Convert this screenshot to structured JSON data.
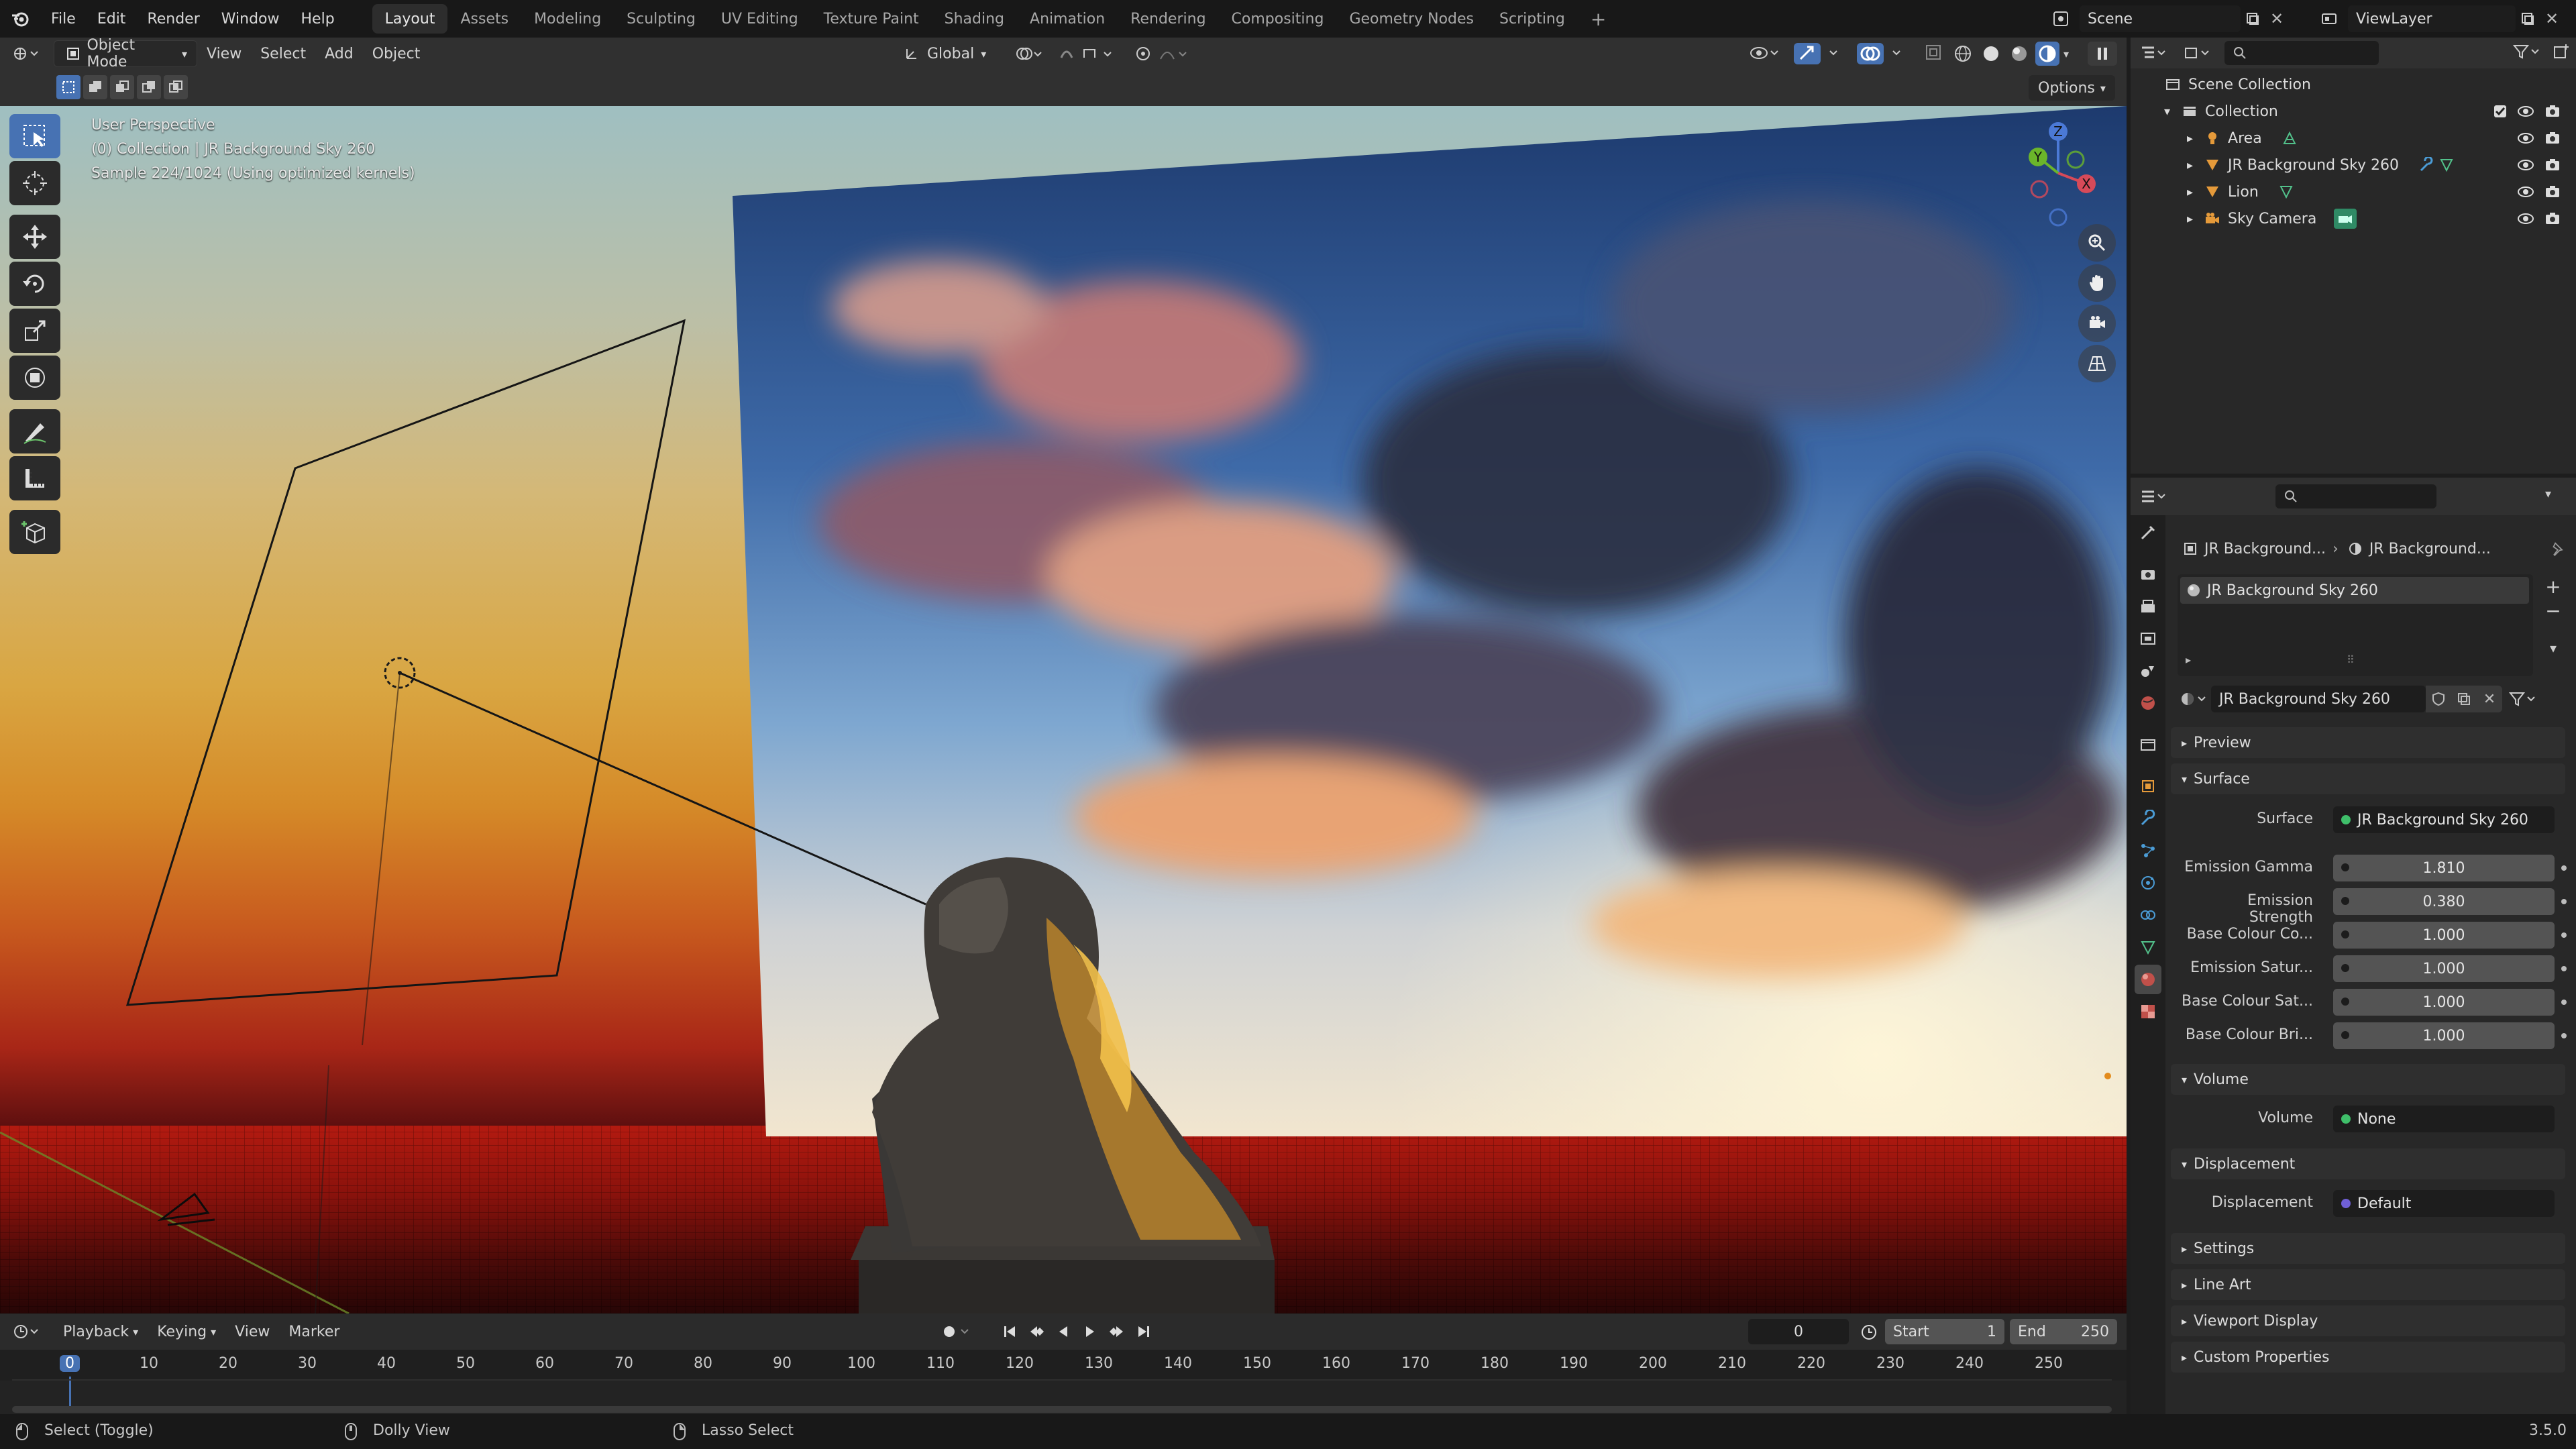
{
  "menubar": {
    "items": [
      "File",
      "Edit",
      "Render",
      "Window",
      "Help"
    ]
  },
  "workspaces": {
    "tabs": [
      "Layout",
      "Assets",
      "Modeling",
      "Sculpting",
      "UV Editing",
      "Texture Paint",
      "Shading",
      "Animation",
      "Rendering",
      "Compositing",
      "Geometry Nodes",
      "Scripting"
    ],
    "add": "+"
  },
  "scene": {
    "name": "Scene"
  },
  "viewlayer": {
    "name": "ViewLayer"
  },
  "viewport_header": {
    "mode": "Object Mode",
    "menus": [
      "View",
      "Select",
      "Add",
      "Object"
    ],
    "transform_orientation": "Global",
    "options": "Options"
  },
  "viewport": {
    "info_line1": "User Perspective",
    "info_line2": "(0) Collection | JR Background Sky 260",
    "info_line3": "Sample 224/1024 (Using optimized kernels)",
    "gizmo_axes": [
      "Z",
      "Y",
      "X"
    ]
  },
  "timeline": {
    "menus": [
      "Playback",
      "Keying",
      "View",
      "Marker"
    ],
    "current_frame": "0",
    "start_label": "Start",
    "start": "1",
    "end_label": "End",
    "end": "250",
    "ticks": [
      "0",
      "10",
      "20",
      "30",
      "40",
      "50",
      "60",
      "70",
      "80",
      "90",
      "100",
      "110",
      "120",
      "130",
      "140",
      "150",
      "160",
      "170",
      "180",
      "190",
      "200",
      "210",
      "220",
      "230",
      "240",
      "250"
    ]
  },
  "status": {
    "select": "Select (Toggle)",
    "dolly": "Dolly View",
    "lasso": "Lasso Select",
    "version": "3.5.0"
  },
  "outliner": {
    "root": "Scene Collection",
    "collection": "Collection",
    "items": [
      {
        "name": "Area"
      },
      {
        "name": "JR Background Sky 260"
      },
      {
        "name": "Lion"
      },
      {
        "name": "Sky Camera"
      }
    ]
  },
  "properties": {
    "breadcrumb1": "JR Background...",
    "breadcrumb2": "JR Background...",
    "material_slot": "JR Background Sky 260",
    "material_name": "JR Background Sky 260",
    "sections": {
      "preview": "Preview",
      "surface": "Surface",
      "volume": "Volume",
      "displacement": "Displacement",
      "settings": "Settings",
      "line_art": "Line Art",
      "viewport_display": "Viewport Display",
      "custom_properties": "Custom Properties"
    },
    "surface": {
      "label": "Surface",
      "value": "JR Background Sky 260"
    },
    "params": [
      {
        "label": "Emission Gamma",
        "value": "1.810"
      },
      {
        "label": "Emission Strength",
        "value": "0.380"
      },
      {
        "label": "Base Colour Co...",
        "value": "1.000"
      },
      {
        "label": "Emission Satur...",
        "value": "1.000"
      },
      {
        "label": "Base Colour Sat...",
        "value": "1.000"
      },
      {
        "label": "Base Colour Bri...",
        "value": "1.000"
      }
    ],
    "volume": {
      "label": "Volume",
      "value": "None"
    },
    "displacement": {
      "label": "Displacement",
      "value": "Default"
    }
  }
}
